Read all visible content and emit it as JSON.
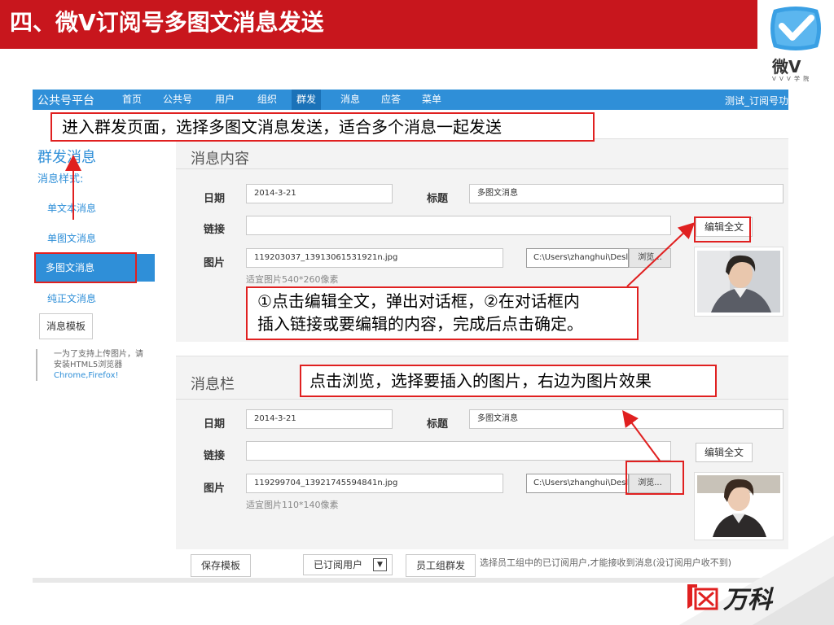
{
  "slide": {
    "title": "四、微V订阅号多图文消息发送",
    "logo_text": "微V",
    "logo_sub": "V V V 学 院",
    "brand_logo_text": "万科"
  },
  "nav": {
    "brand": "公共号平台",
    "items": [
      "首页",
      "公共号",
      "用户",
      "组织",
      "群发",
      "消息",
      "应答",
      "菜单"
    ],
    "active": "群发",
    "user": "测试_订阅号功"
  },
  "sidebar": {
    "title": "群发消息",
    "subtitle": "消息样式:",
    "items": [
      "单文本消息",
      "单图文消息",
      "多图文消息",
      "纯正文消息"
    ],
    "active": "多图文消息",
    "template_button": "消息模板",
    "note_prefix": "一为了支持上传图片，请安装HTML5浏览器",
    "note_browsers": "Chrome,Firefox!"
  },
  "panel1": {
    "title": "消息内容",
    "date_label": "日期",
    "date_value": "2014-3-21",
    "title_label": "标题",
    "title_value": "多图文消息",
    "link_label": "链接",
    "link_value": "",
    "edit_button": "编辑全文",
    "image_label": "图片",
    "image_value": "119203037_13913061531921n.jpg",
    "hint": "适宜图片540*260像素",
    "file_path": "C:\\Users\\zhanghui\\Desl",
    "browse_button": "浏览..."
  },
  "panel2": {
    "title": "消息栏",
    "date_label": "日期",
    "date_value": "2014-3-21",
    "title_label": "标题",
    "title_value": "多图文消息",
    "link_label": "链接",
    "link_value": "",
    "edit_button": "编辑全文",
    "image_label": "图片",
    "image_value": "119299704_13921745594841n.jpg",
    "hint": "适宜图片110*140像素",
    "file_path": "C:\\Users\\zhanghui\\Desl",
    "browse_button": "浏览..."
  },
  "bottom": {
    "save_button": "保存模板",
    "select_value": "已订阅用户",
    "group_send_button": "员工组群发",
    "hint": "选择员工组中的已订阅用户,才能接收到消息(没订阅用户收不到)"
  },
  "annotations": {
    "a1": "进入群发页面，选择多图文消息发送，适合多个消息一起发送",
    "a2_line1": "①点击编辑全文，弹出对话框，②在对话框内",
    "a2_line2": "插入链接或要编辑的内容，完成后点击确定。",
    "a3": "点击浏览，选择要插入的图片，右边为图片效果"
  },
  "colors": {
    "header_red": "#c8161d",
    "nav_blue": "#2f8fd8",
    "annotation_red": "#e02020"
  }
}
